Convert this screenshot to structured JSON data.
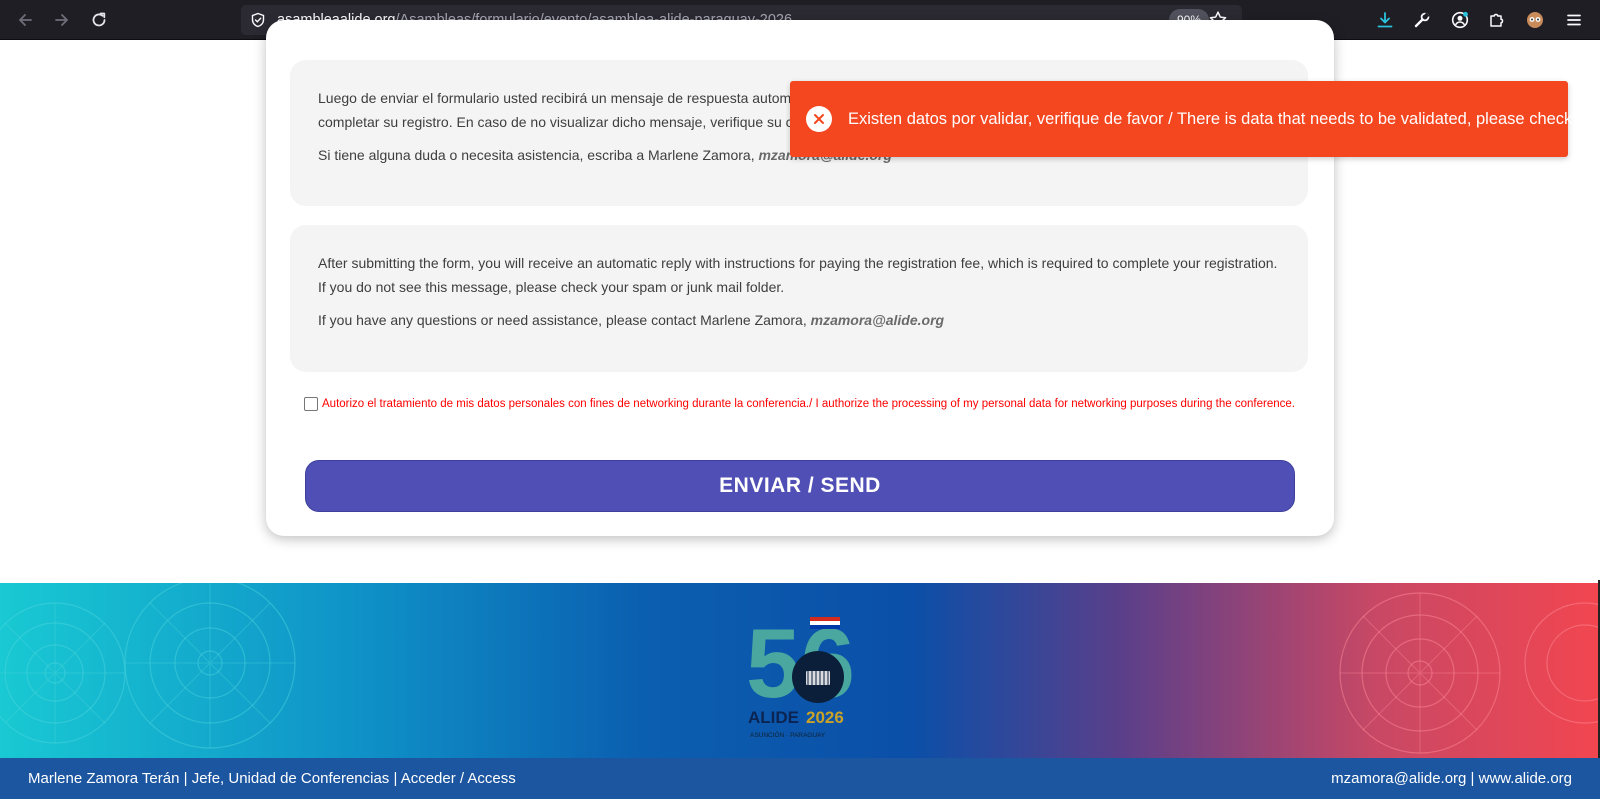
{
  "browser": {
    "url_host": "asambleaalide.org",
    "url_path": "/Asambleas/formulario/evento/asamblea-alide-paraguay-2026",
    "zoom": "90%",
    "icons": [
      "back-icon",
      "forward-icon",
      "reload-icon",
      "shield-icon",
      "star-icon",
      "download-icon",
      "wrench-icon",
      "account-icon",
      "extensions-icon",
      "profile-icon",
      "menu-icon"
    ]
  },
  "form": {
    "spanish_box": {
      "line1": "Luego de enviar el formulario usted recibirá un mensaje de respuesta automático",
      "line2": "completar su registro. En caso de no visualizar dicho mensaje, verifique su casill",
      "contact_prefix": "Si tiene alguna duda o necesita asistencia, escriba a Marlene Zamora,",
      "contact_email": "mzamora@alide.org"
    },
    "english_box": {
      "body": "After submitting the form, you will receive an automatic reply with instructions for paying the registration fee, which is required to complete your registration. If you do not see this message, please check your spam or junk mail folder.",
      "contact_prefix": "If you have any questions or need assistance, please contact Marlene Zamora,",
      "contact_email": "mzamora@alide.org"
    },
    "consent_label": "Autorizo el tratamiento de mis datos personales con fines de networking durante la conferencia./ I authorize the processing of my personal data for networking purposes during the conference.",
    "consent_checked": false,
    "submit_label": "ENVIAR / SEND"
  },
  "toast": {
    "message": "Existen datos por validar, verifique de favor / There is data that needs to be validated, please check",
    "color": "#f4461f",
    "icon": "error-x-icon"
  },
  "footer": {
    "logo": {
      "number": "56",
      "brand": "ALIDE",
      "year": "2026",
      "city": "ASUNCIÓN · PARAGUAY"
    },
    "left_text": "Marlene Zamora Terán | Jefe, Unidad de Conferencias | Acceder / Access",
    "right_text": "mzamora@alide.org | www.alide.org"
  }
}
